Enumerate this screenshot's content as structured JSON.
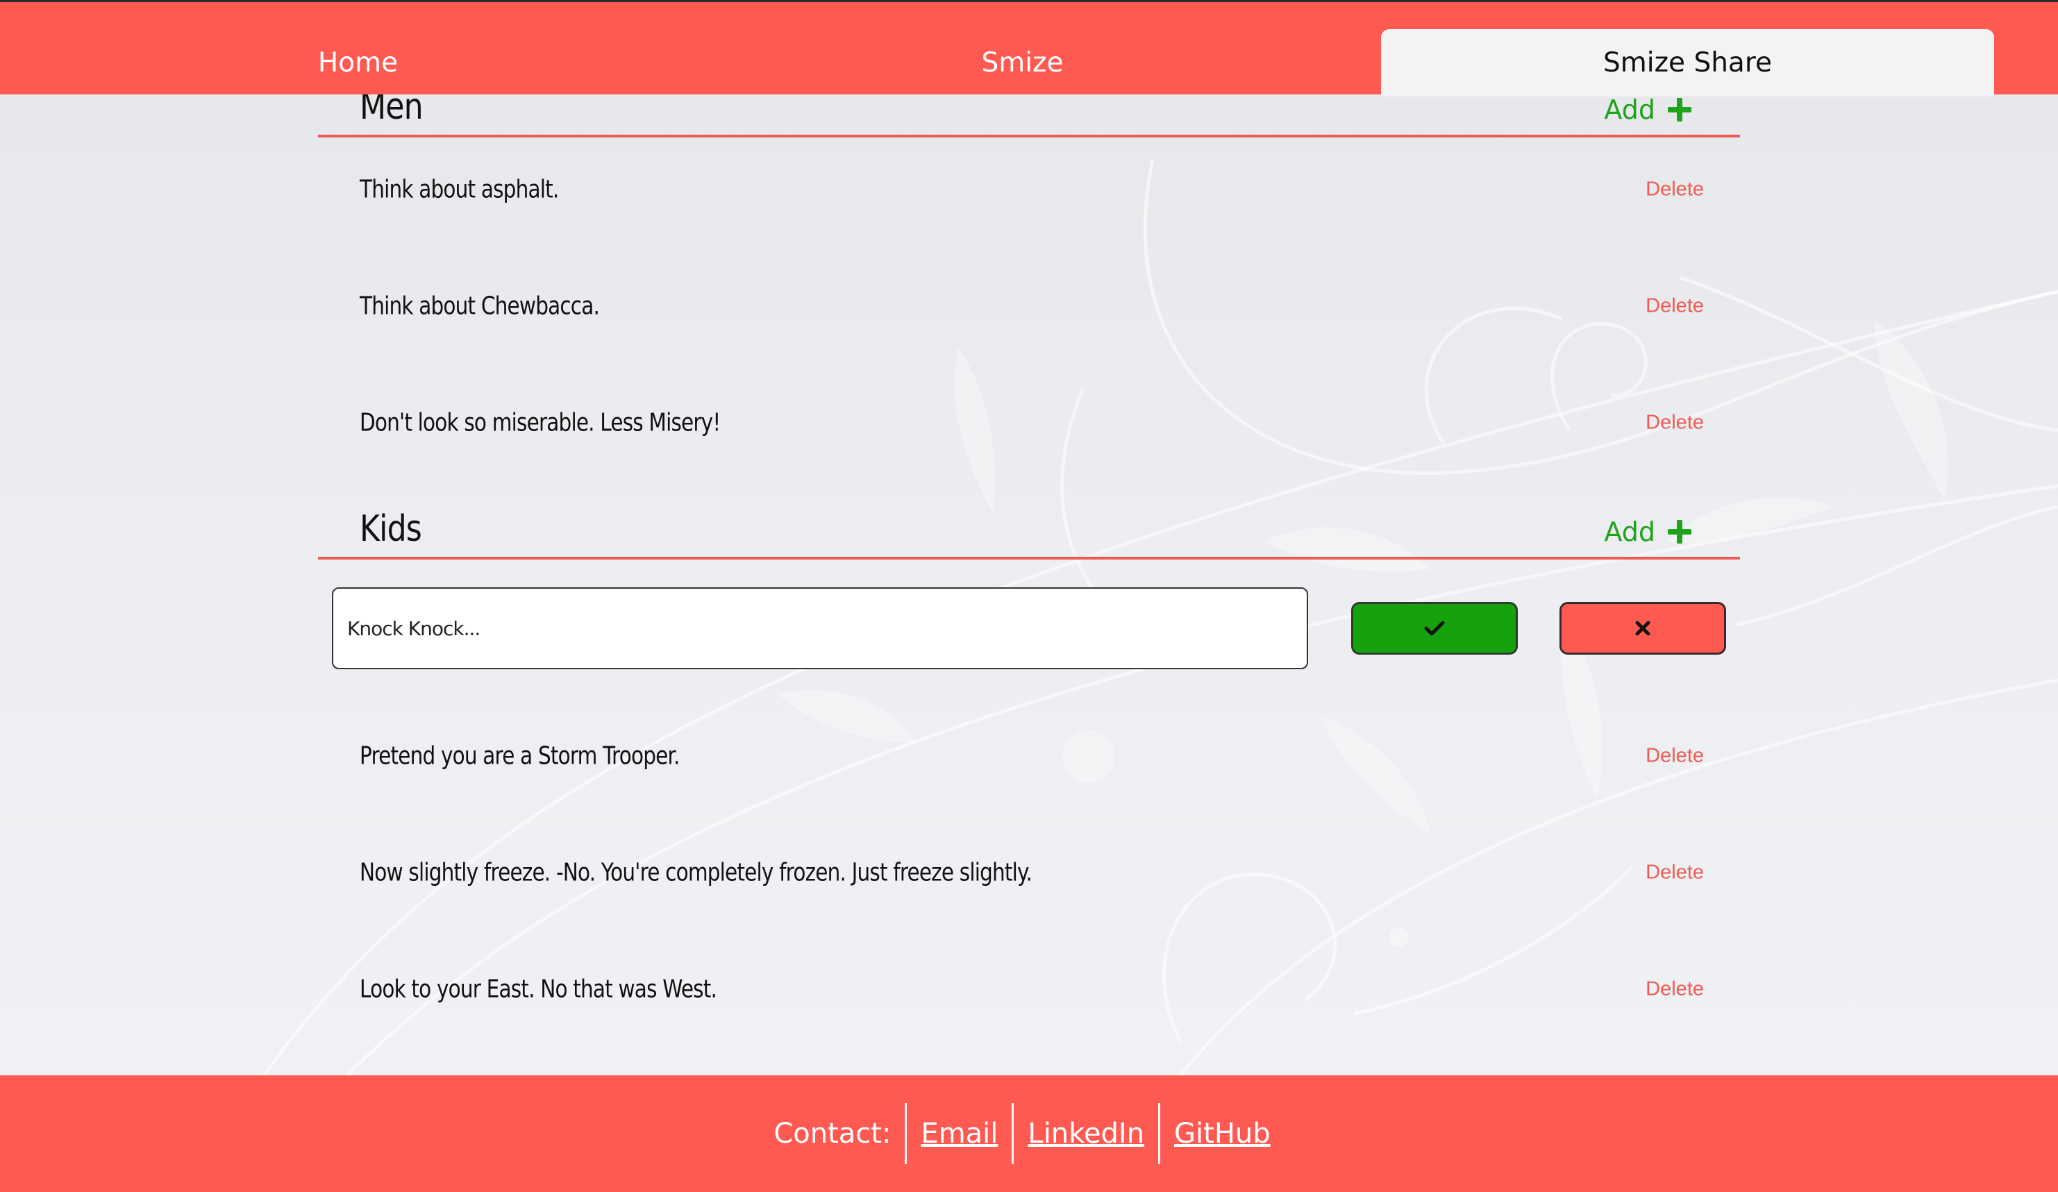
{
  "nav": {
    "tabs": [
      {
        "label": "Home",
        "active": false
      },
      {
        "label": "Smize",
        "active": false
      },
      {
        "label": "Smize Share",
        "active": true
      }
    ]
  },
  "sections": [
    {
      "title": "Men",
      "add_label": "Add",
      "items": [
        {
          "text": "Think about asphalt.",
          "delete_label": "Delete"
        },
        {
          "text": "Think about Chewbacca.",
          "delete_label": "Delete"
        },
        {
          "text": "Don't look so miserable. Less Misery!",
          "delete_label": "Delete"
        }
      ]
    },
    {
      "title": "Kids",
      "add_label": "Add",
      "edit": {
        "value": "Knock Knock..."
      },
      "items": [
        {
          "text": "Pretend you are a Storm Trooper.",
          "delete_label": "Delete"
        },
        {
          "text": "Now slightly freeze. -No. You're completely frozen. Just freeze slightly.",
          "delete_label": "Delete"
        },
        {
          "text": "Look to your East. No that was West.",
          "delete_label": "Delete"
        }
      ]
    }
  ],
  "footer": {
    "label": "Contact:",
    "links": [
      "Email",
      "LinkedIn",
      "GitHub"
    ]
  },
  "icons": {
    "add": "plus-icon",
    "confirm": "check-icon",
    "cancel": "close-icon"
  },
  "colors": {
    "brand": "#ff5a52",
    "accent_green": "#16a10f",
    "add_green": "#1fa31b",
    "delete_red": "#ef5b53"
  }
}
